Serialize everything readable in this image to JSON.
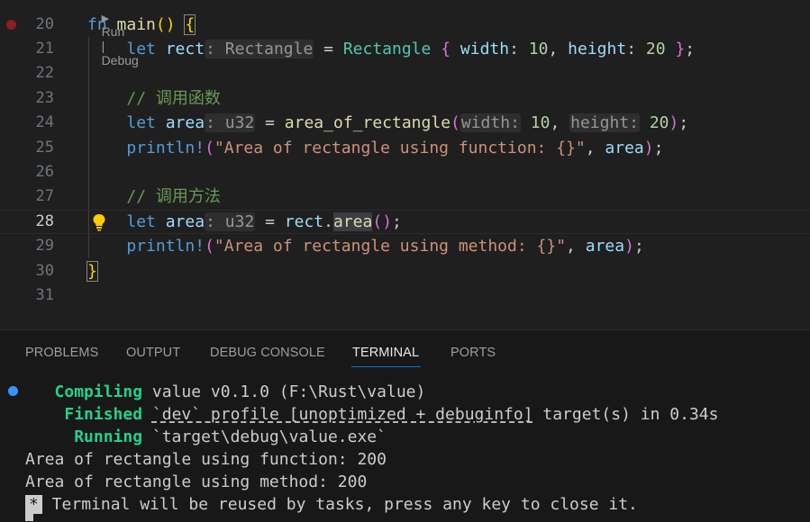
{
  "editor": {
    "codelens": {
      "run": "Run",
      "sep": "|",
      "debug": "Debug"
    },
    "lines": [
      {
        "n": "20"
      },
      {
        "n": "21"
      },
      {
        "n": "22"
      },
      {
        "n": "23"
      },
      {
        "n": "24"
      },
      {
        "n": "25"
      },
      {
        "n": "26"
      },
      {
        "n": "27"
      },
      {
        "n": "28"
      },
      {
        "n": "29"
      },
      {
        "n": "30"
      },
      {
        "n": "31"
      }
    ],
    "tokens": {
      "fn": "fn",
      "main": "main",
      "let": "let",
      "rect": "rect",
      "area": "area",
      "Rectangle": "Rectangle",
      "width": "width",
      "height": "height",
      "n10": "10",
      "n20": "20",
      "u32": "u32",
      "area_of_rectangle": "area_of_rectangle",
      "println": "println!",
      "comment1": "// 调用函数",
      "comment2": "// 调用方法",
      "str1": "\"Area of rectangle using function: {}\"",
      "str2": "\"Area of rectangle using method: {}\""
    },
    "colors": {
      "breakpoint": "#8a1f24",
      "bulb": "#ffcc00"
    }
  },
  "panel": {
    "tabs": [
      "PROBLEMS",
      "OUTPUT",
      "DEBUG CONSOLE",
      "TERMINAL",
      "PORTS"
    ],
    "active_tab": "TERMINAL",
    "terminal": {
      "compiling_label": "Compiling",
      "compiling_text": " value v0.1.0 (F:\\Rust\\value)",
      "finished_label": "Finished",
      "finished_profile": "`dev` profile [unoptimized + debuginfo]",
      "finished_rest": " target(s) in 0.34s",
      "running_label": "Running",
      "running_text": " `target\\debug\\value.exe`",
      "out1": "Area of rectangle using function: 200",
      "out2": "Area of rectangle using method: 200",
      "star": "*",
      "reuse_msg": " Terminal will be reused by tasks, press any key to close it."
    }
  }
}
